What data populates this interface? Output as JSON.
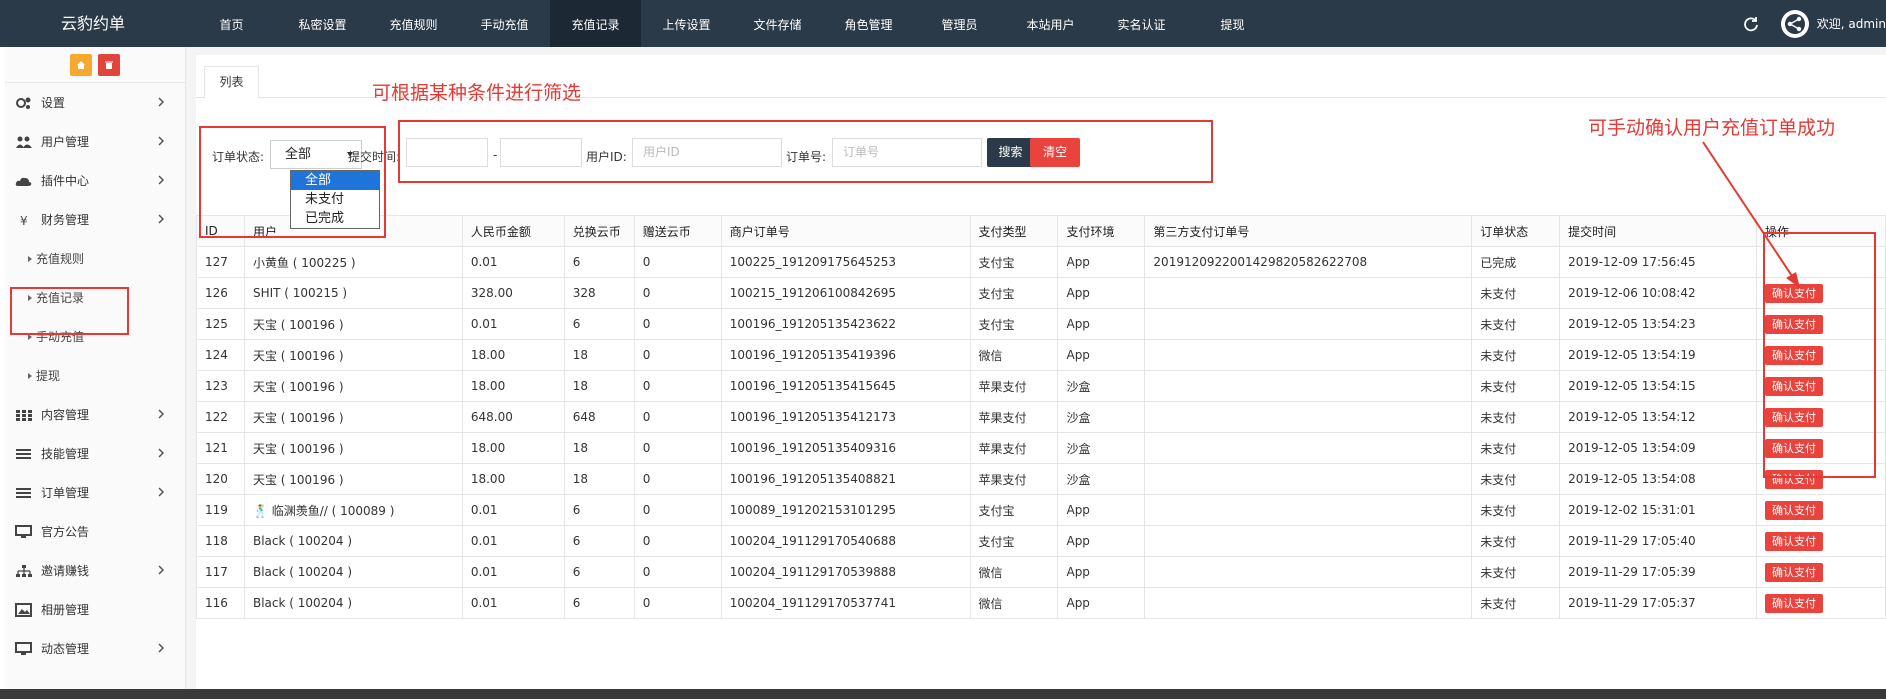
{
  "app": {
    "title": "云豹约单"
  },
  "nav": {
    "items": [
      {
        "label": "首页"
      },
      {
        "label": "私密设置"
      },
      {
        "label": "充值规则"
      },
      {
        "label": "手动充值"
      },
      {
        "label": "充值记录"
      },
      {
        "label": "上传设置"
      },
      {
        "label": "文件存储"
      },
      {
        "label": "角色管理"
      },
      {
        "label": "管理员"
      },
      {
        "label": "本站用户"
      },
      {
        "label": "实名认证"
      },
      {
        "label": "提现"
      }
    ],
    "active": "充值记录"
  },
  "topright": {
    "welcome": "欢迎, admin"
  },
  "sidebar": {
    "menu": [
      {
        "label": "设置",
        "icon": "gears-icon"
      },
      {
        "label": "用户管理",
        "icon": "users-icon"
      },
      {
        "label": "插件中心",
        "icon": "cloud-icon"
      },
      {
        "label": "财务管理",
        "icon": "yen-icon"
      }
    ],
    "sub": [
      {
        "label": "充值规则"
      },
      {
        "label": "充值记录"
      },
      {
        "label": "手动充值"
      },
      {
        "label": "提现"
      }
    ],
    "menu2": [
      {
        "label": "内容管理",
        "icon": "grid-icon"
      },
      {
        "label": "技能管理",
        "icon": "list-icon"
      },
      {
        "label": "订单管理",
        "icon": "list-icon"
      },
      {
        "label": "官方公告",
        "icon": "monitor-icon"
      },
      {
        "label": "邀请赚钱",
        "icon": "sitemap-icon"
      },
      {
        "label": "相册管理",
        "icon": "image-icon"
      },
      {
        "label": "动态管理",
        "icon": "monitor-icon"
      }
    ]
  },
  "tabs": {
    "list": "列表"
  },
  "filters": {
    "status_label": "订单状态:",
    "status_value": "全部",
    "status_options": [
      "全部",
      "未支付",
      "已完成"
    ],
    "time_label": "提交时间:",
    "time_separator": "-",
    "uid_label": "用户ID:",
    "uid_placeholder": "用户ID",
    "order_label": "订单号:",
    "order_placeholder": "订单号",
    "search": "搜索",
    "clear": "清空"
  },
  "table": {
    "headers": [
      "ID",
      "用户",
      "人民币金额",
      "兑换云币",
      "赠送云币",
      "商户订单号",
      "支付类型",
      "支付环境",
      "第三方支付订单号",
      "订单状态",
      "提交时间",
      "操作"
    ],
    "op_label": "确认支付",
    "rows": [
      [
        "127",
        "小黄鱼 ( 100225 )",
        "0.01",
        "6",
        "0",
        "100225_191209175645253",
        "支付宝",
        "App",
        "2019120922001429820582622708",
        "已完成",
        "2019-12-09 17:56:45",
        ""
      ],
      [
        "126",
        "SHIT ( 100215 )",
        "328.00",
        "328",
        "0",
        "100215_191206100842695",
        "支付宝",
        "App",
        "",
        "未支付",
        "2019-12-06 10:08:42",
        "op"
      ],
      [
        "125",
        "天宝 ( 100196 )",
        "0.01",
        "6",
        "0",
        "100196_191205135423622",
        "支付宝",
        "App",
        "",
        "未支付",
        "2019-12-05 13:54:23",
        "op"
      ],
      [
        "124",
        "天宝 ( 100196 )",
        "18.00",
        "18",
        "0",
        "100196_191205135419396",
        "微信",
        "App",
        "",
        "未支付",
        "2019-12-05 13:54:19",
        "op"
      ],
      [
        "123",
        "天宝 ( 100196 )",
        "18.00",
        "18",
        "0",
        "100196_191205135415645",
        "苹果支付",
        "沙盒",
        "",
        "未支付",
        "2019-12-05 13:54:15",
        "op"
      ],
      [
        "122",
        "天宝 ( 100196 )",
        "648.00",
        "648",
        "0",
        "100196_191205135412173",
        "苹果支付",
        "沙盒",
        "",
        "未支付",
        "2019-12-05 13:54:12",
        "op"
      ],
      [
        "121",
        "天宝 ( 100196 )",
        "18.00",
        "18",
        "0",
        "100196_191205135409316",
        "苹果支付",
        "沙盒",
        "",
        "未支付",
        "2019-12-05 13:54:09",
        "op"
      ],
      [
        "120",
        "天宝 ( 100196 )",
        "18.00",
        "18",
        "0",
        "100196_191205135408821",
        "苹果支付",
        "沙盒",
        "",
        "未支付",
        "2019-12-05 13:54:08",
        "op"
      ],
      [
        "119",
        "🕺 临渊羡鱼// ( 100089 )",
        "0.01",
        "6",
        "0",
        "100089_191202153101295",
        "支付宝",
        "App",
        "",
        "未支付",
        "2019-12-02 15:31:01",
        "op"
      ],
      [
        "118",
        "Black ( 100204 )",
        "0.01",
        "6",
        "0",
        "100204_191129170540688",
        "支付宝",
        "App",
        "",
        "未支付",
        "2019-11-29 17:05:40",
        "op"
      ],
      [
        "117",
        "Black ( 100204 )",
        "0.01",
        "6",
        "0",
        "100204_191129170539888",
        "微信",
        "App",
        "",
        "未支付",
        "2019-11-29 17:05:39",
        "op"
      ],
      [
        "116",
        "Black ( 100204 )",
        "0.01",
        "6",
        "0",
        "100204_191129170537741",
        "微信",
        "App",
        "",
        "未支付",
        "2019-11-29 17:05:37",
        "op"
      ]
    ]
  },
  "annotations": {
    "filter_note": "可根据某种条件进行筛选",
    "confirm_note": "可手动确认用户充值订单成功"
  },
  "colors": {
    "topbar": "#2b3a48",
    "accent_red": "#e8433c",
    "annotation": "#e53935"
  }
}
